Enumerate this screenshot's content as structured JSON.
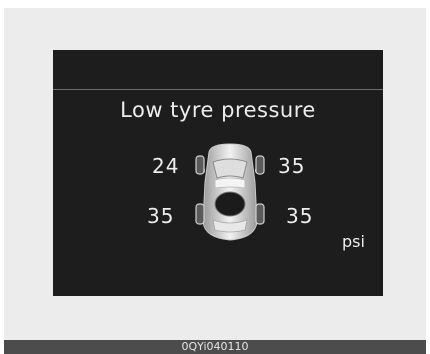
{
  "display": {
    "title": "Low tyre pressure",
    "tyres": {
      "front_left": "24",
      "front_right": "35",
      "rear_left": "35",
      "rear_right": "35"
    },
    "unit": "psi"
  },
  "caption": "0QYi040110",
  "colors": {
    "screen_bg": "#1d1d1d",
    "text": "#ededed",
    "frame_bg": "#ececec",
    "caption_bar": "#4c4c4c"
  },
  "icons": [
    "car-top-view-icon"
  ]
}
